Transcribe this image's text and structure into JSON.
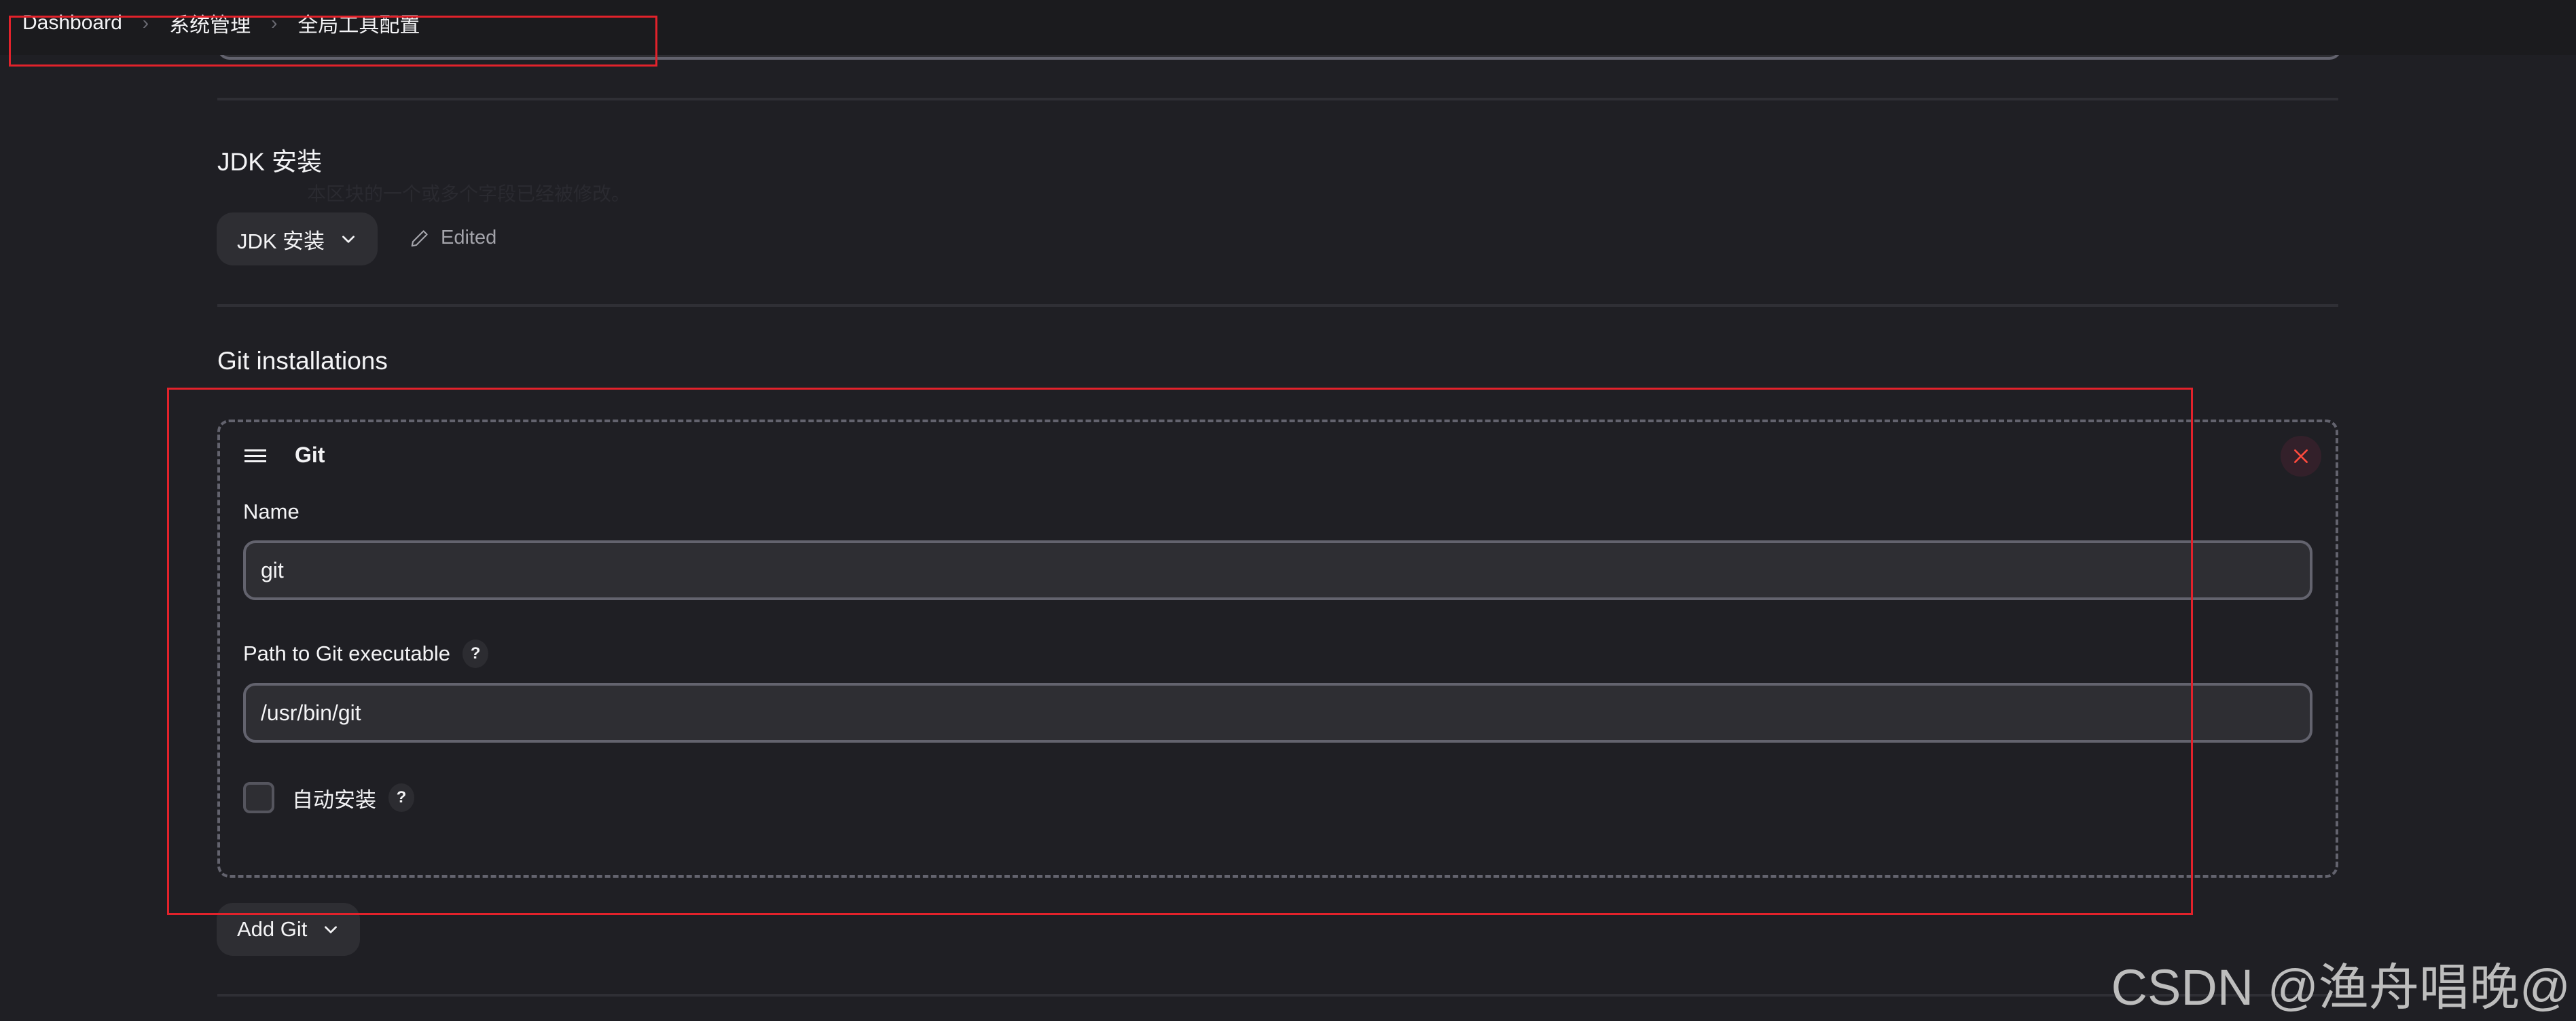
{
  "breadcrumb": {
    "items": [
      "Dashboard",
      "系统管理",
      "全局工具配置"
    ],
    "separator": "›"
  },
  "jdk_section": {
    "title": "JDK 安装",
    "button_label": "JDK 安装",
    "edited_label": "Edited",
    "edited_tooltip": "本区块的一个或多个字段已经被修改。"
  },
  "git_section": {
    "title": "Git installations",
    "card": {
      "title": "Git",
      "name_label": "Name",
      "name_value": "git",
      "path_label": "Path to Git executable",
      "path_value": "/usr/bin/git",
      "auto_install_label": "自动安装",
      "auto_install_checked": false,
      "help_glyph": "?"
    },
    "add_button_label": "Add Git"
  },
  "icons": {
    "separator": "chevron-right-icon",
    "dropdown": "chevron-down-icon",
    "edited": "pencil-icon",
    "drag": "hamburger-drag-icon",
    "close": "close-icon"
  },
  "colors": {
    "background": "#1f1f24",
    "topbar": "#1b1b1e",
    "input_bg": "#2e2e33",
    "border": "#63636e",
    "danger": "#ff4a3d",
    "annotation": "#e2222b"
  },
  "watermark": "CSDN @渔舟唱晚@"
}
